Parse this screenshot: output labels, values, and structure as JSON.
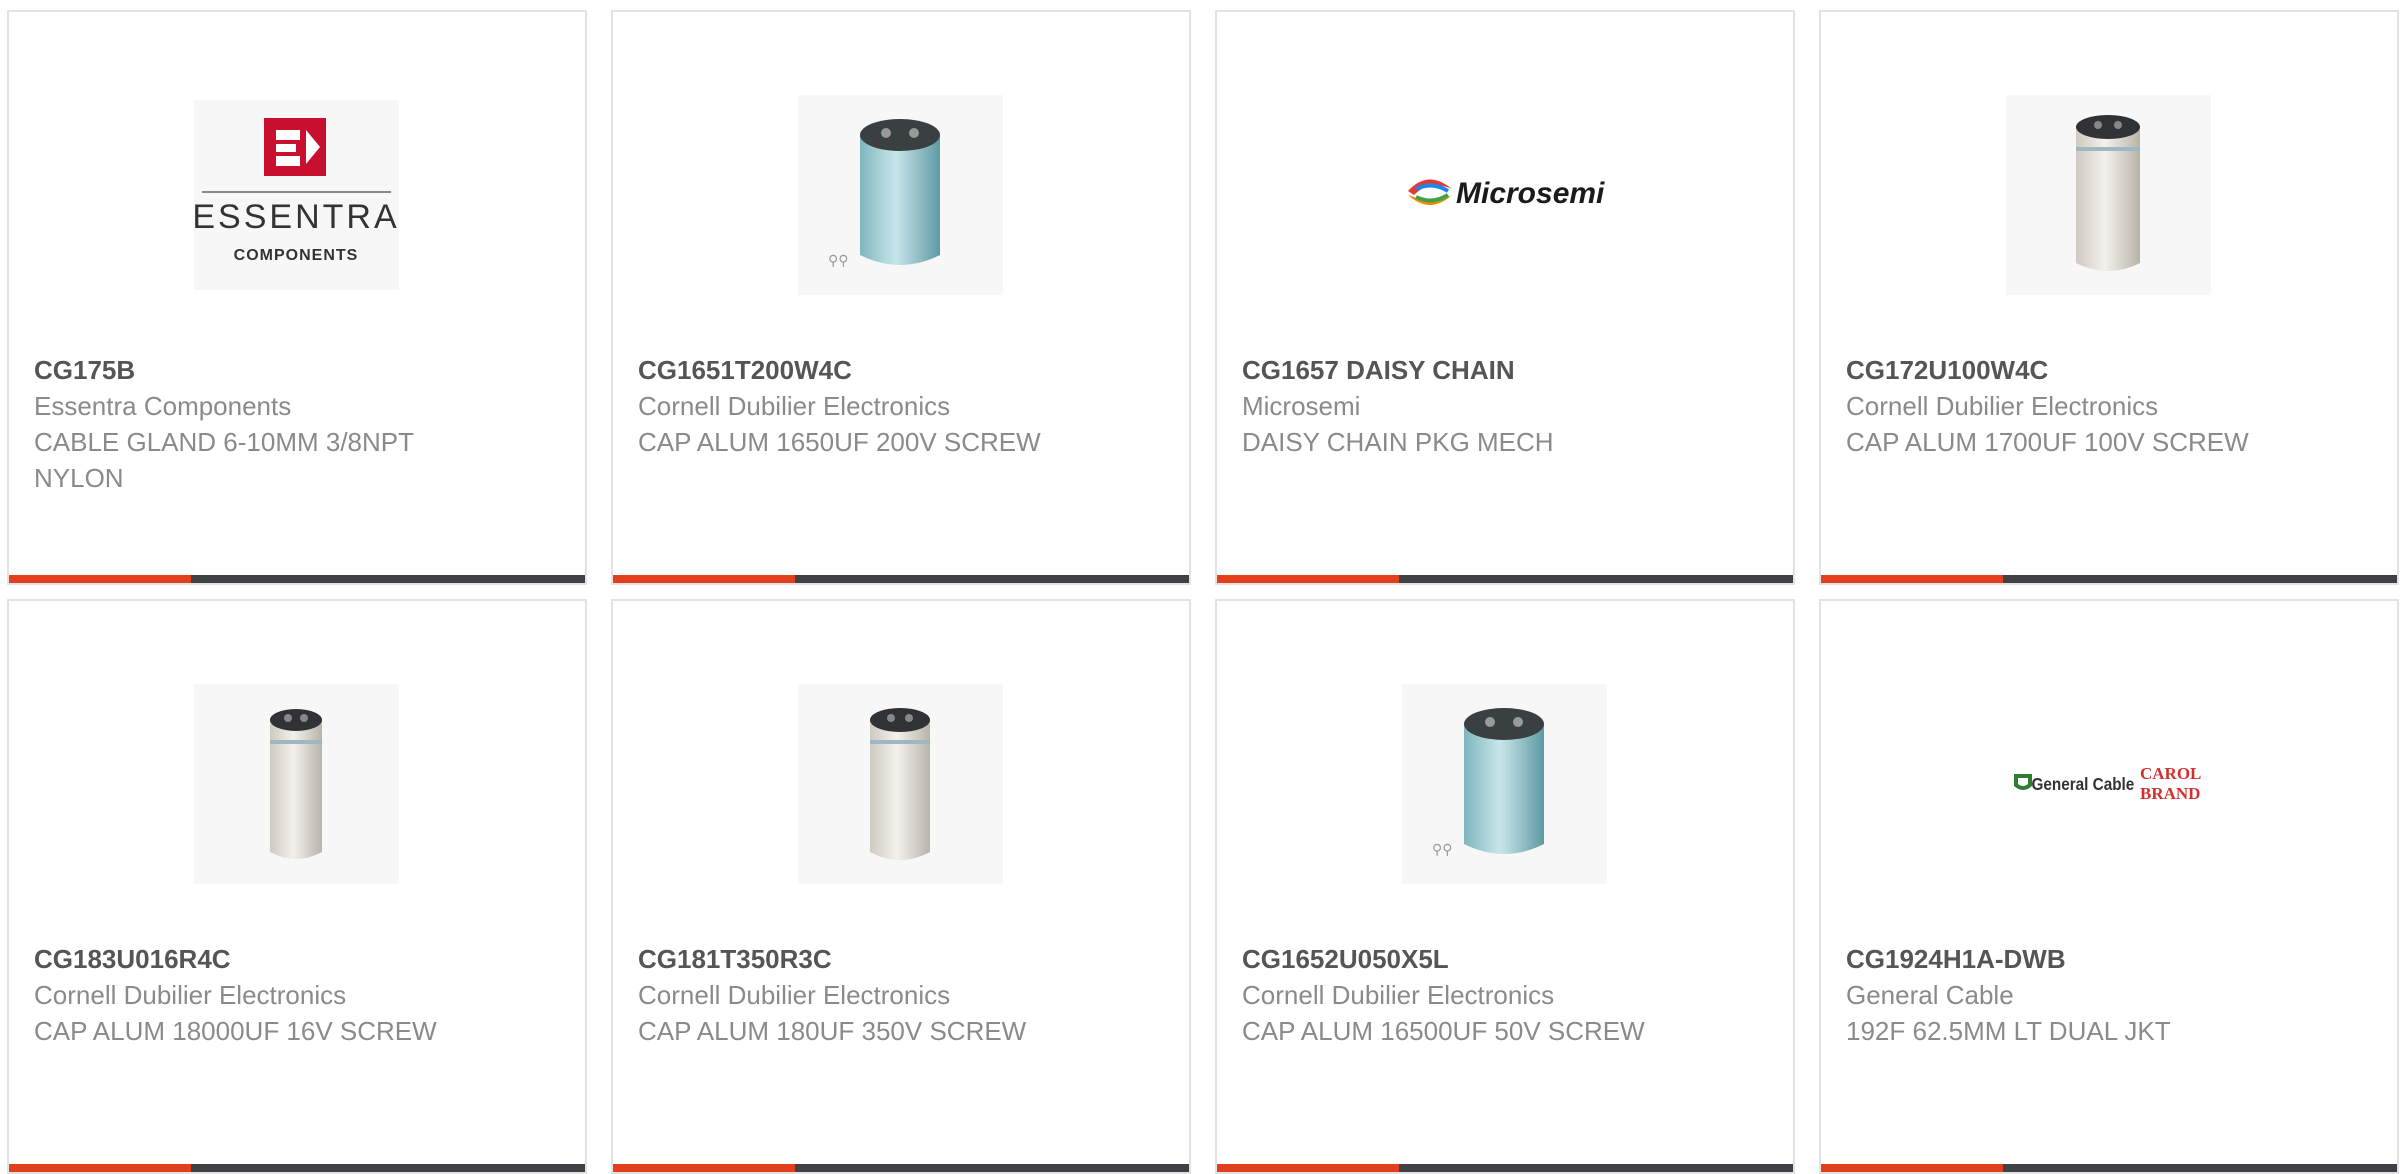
{
  "products": [
    {
      "part": "CG175B",
      "manufacturer": "Essentra Components",
      "description": "CABLE GLAND 6-10MM 3/8NPT NYLON",
      "image": "essentra-logo",
      "logo_text": "ESSENTRA",
      "logo_sub": "COMPONENTS"
    },
    {
      "part": "CG1651T200W4C",
      "manufacturer": "Cornell Dubilier Electronics",
      "description": "CAP ALUM 1650UF 200V SCREW",
      "image": "blue-capacitor-with-screws"
    },
    {
      "part": "CG1657 DAISY CHAIN",
      "manufacturer": "Microsemi",
      "description": "DAISY CHAIN PKG MECH",
      "image": "microsemi-logo",
      "logo_text": "Microsemi"
    },
    {
      "part": "CG172U100W4C",
      "manufacturer": "Cornell Dubilier Electronics",
      "description": "CAP ALUM 1700UF 100V SCREW",
      "image": "silver-capacitor"
    },
    {
      "part": "CG183U016R4C",
      "manufacturer": "Cornell Dubilier Electronics",
      "description": "CAP ALUM 18000UF 16V SCREW",
      "image": "silver-capacitor"
    },
    {
      "part": "CG181T350R3C",
      "manufacturer": "Cornell Dubilier Electronics",
      "description": "CAP ALUM 180UF 350V SCREW",
      "image": "silver-capacitor"
    },
    {
      "part": "CG1652U050X5L",
      "manufacturer": "Cornell Dubilier Electronics",
      "description": "CAP ALUM 16500UF 50V SCREW",
      "image": "blue-capacitor-with-screws"
    },
    {
      "part": "CG1924H1A-DWB",
      "manufacturer": "General Cable",
      "description": "192F 62.5MM LT DUAL JKT",
      "image": "general-cable-logo",
      "logo_text": "General Cable",
      "logo_text2": "CAROL",
      "logo_text3": "BRAND"
    }
  ],
  "colors": {
    "accent": "#e2401c",
    "bar": "#3f4145",
    "border": "#e2e2e2",
    "part_text": "#555555",
    "meta_text": "#8a8a8a",
    "essentra_red": "#c8102e",
    "microsemi_text": "#1a1a1a",
    "general_cable_green": "#2e7d32",
    "carol_red": "#d32f2f"
  }
}
